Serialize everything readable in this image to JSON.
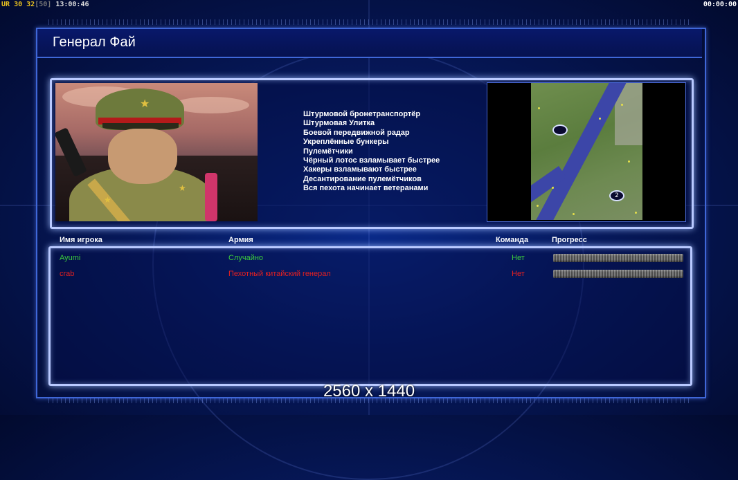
{
  "hud": {
    "left_prefix": "UR",
    "left_val1": "30",
    "left_val2": "32",
    "left_val3": "[50]",
    "left_time": "13:00:46",
    "right_time": "00:00:00"
  },
  "title": "Генерал Фай",
  "features": [
    "Штурмовой бронетранспортёр",
    "Штурмовая Улитка",
    "Боевой передвижной радар",
    "Укреплённые бункеры",
    "Пулемётчики",
    "Чёрный лотос взламывает быстрее",
    "Хакеры взламывают быстрее",
    "Десантирование пулемётчиков",
    "Вся пехота начинает ветеранами"
  ],
  "minimap": {
    "marker_2_label": "2"
  },
  "table": {
    "headers": {
      "player": "Имя игрока",
      "army": "Армия",
      "team": "Команда",
      "progress": "Прогресс"
    },
    "rows": [
      {
        "player": "Ayumi",
        "army": "Случайно",
        "team": "Нет",
        "color": "#3ccc3c",
        "progress": 1.0
      },
      {
        "player": "crab",
        "army": "Пехотный китайский генерал",
        "team": "Нет",
        "color": "#e62020",
        "progress": 1.0
      }
    ]
  },
  "resolution": "2560 x 1440"
}
